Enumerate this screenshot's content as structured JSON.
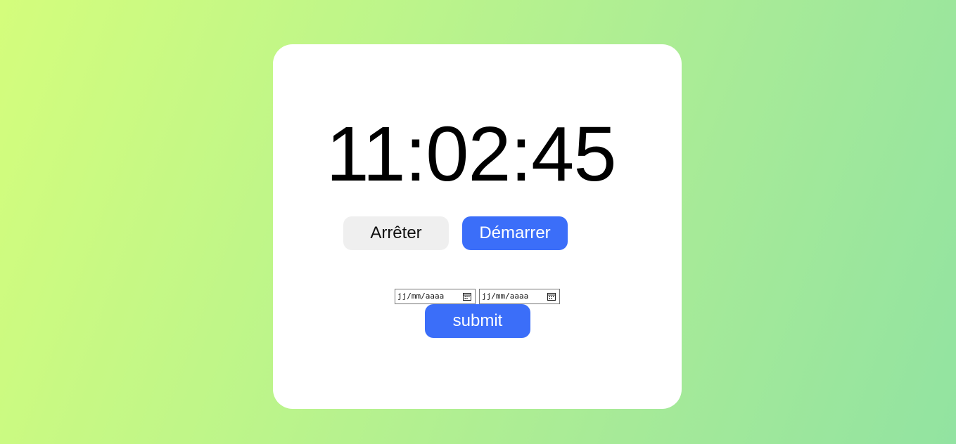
{
  "timer": {
    "display": "11:02:45"
  },
  "controls": {
    "stop_label": "Arrêter",
    "start_label": "Démarrer"
  },
  "date_range": {
    "start_placeholder": "jj/mm/aaaa",
    "end_placeholder": "jj/mm/aaaa",
    "submit_label": "submit"
  },
  "colors": {
    "accent": "#3b6ef9",
    "secondary_button": "#efefef",
    "card": "#ffffff",
    "background_start": "#d4fd7c",
    "background_end": "#92e3a1"
  },
  "icons": {
    "date_picker": "calendar-icon"
  }
}
